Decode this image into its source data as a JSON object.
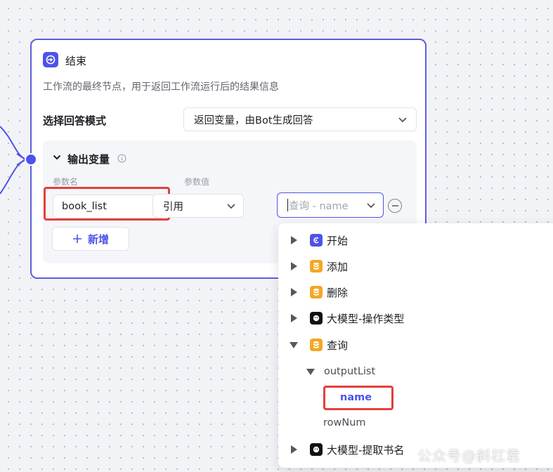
{
  "node": {
    "title": "结束",
    "description": "工作流的最终节点，用于返回工作流运行后的结果信息",
    "mode_label": "选择回答模式",
    "mode_value": "返回变量，由Bot生成回答"
  },
  "output": {
    "title": "输出变量",
    "param_name_label": "参数名",
    "param_value_label": "参数值",
    "param_name_value": "book_list",
    "value_type": "引用",
    "query_placeholder": "查询 - name",
    "add_label": "新增"
  },
  "dropdown": {
    "items": [
      {
        "label": "开始",
        "icon": "start-icon"
      },
      {
        "label": "添加",
        "icon": "database-icon"
      },
      {
        "label": "删除",
        "icon": "database-icon"
      },
      {
        "label": "大模型-操作类型",
        "icon": "llm-icon"
      },
      {
        "label": "查询",
        "icon": "database-icon"
      },
      {
        "label": "大模型-提取书名",
        "icon": "llm-icon"
      }
    ],
    "sub": {
      "output_list": "outputList",
      "name": "name",
      "row_num": "rowNum"
    }
  },
  "colors": {
    "accent": "#4d53e8",
    "highlight": "#e2403d",
    "db": "#f5a623"
  },
  "watermark": "公众号@斜杠君"
}
